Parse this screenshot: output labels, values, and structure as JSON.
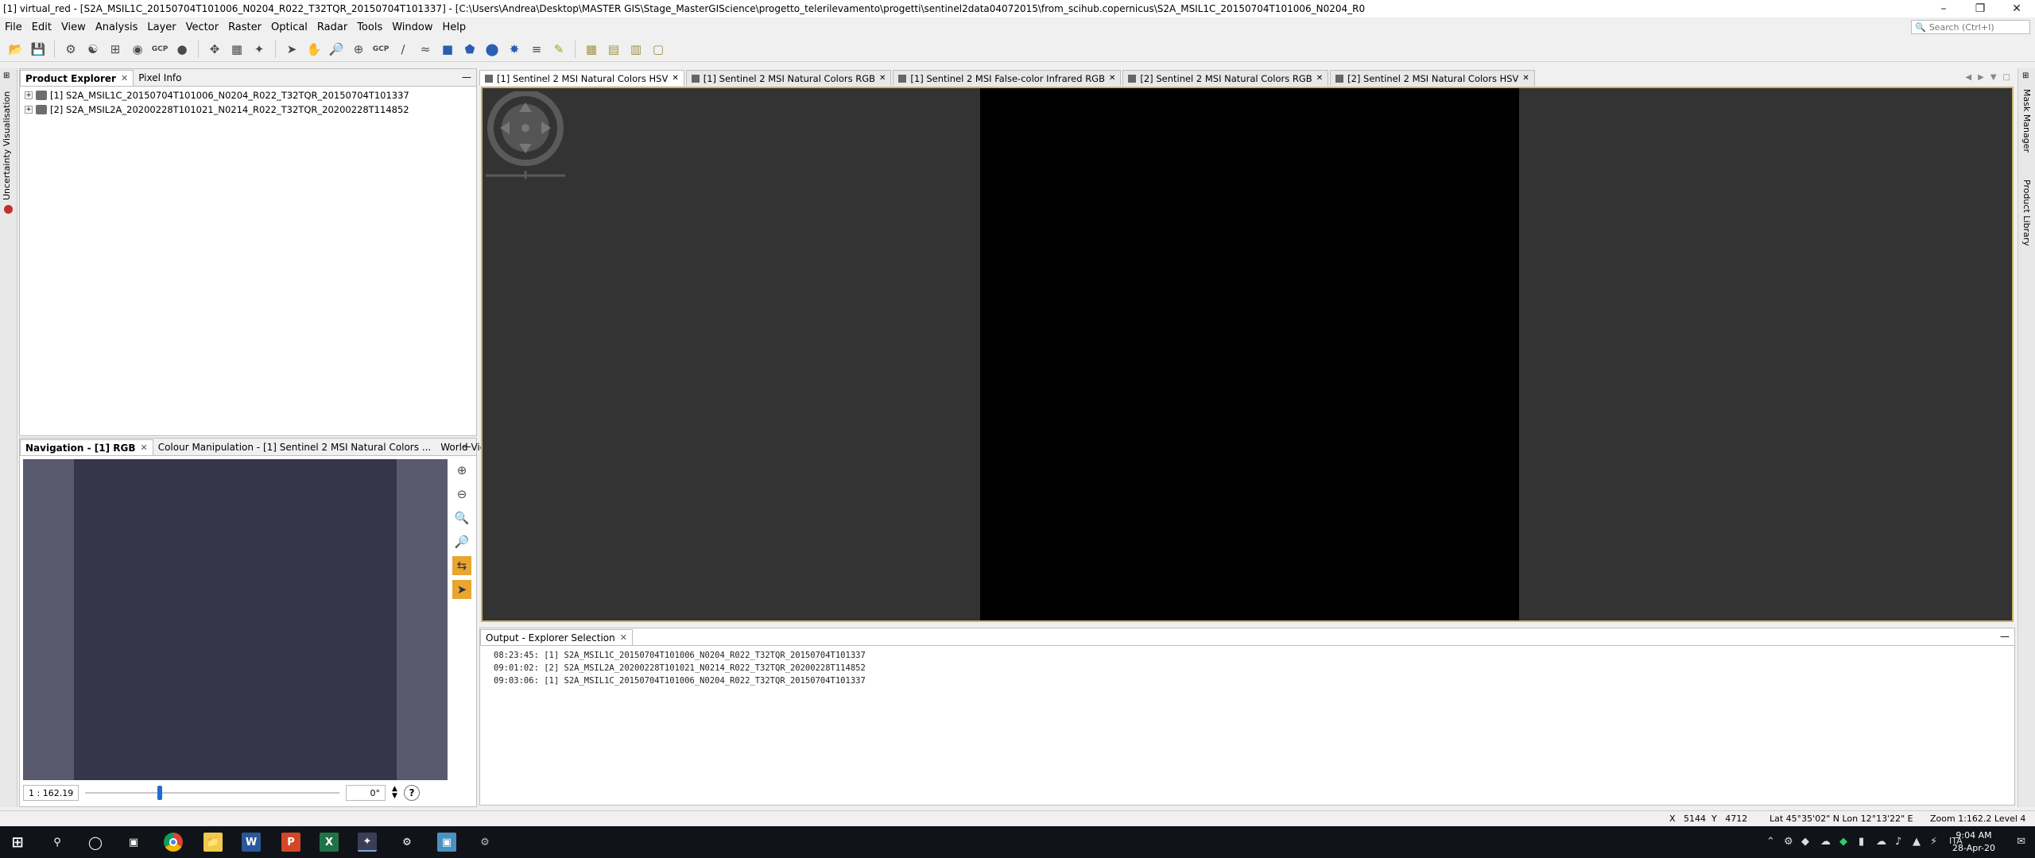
{
  "window": {
    "title": "[1] virtual_red - [S2A_MSIL1C_20150704T101006_N0204_R022_T32TQR_20150704T101337] - [C:\\Users\\Andrea\\Desktop\\MASTER GIS\\Stage_MasterGIScience\\progetto_telerilevamento\\progetti\\sentinel2data04072015\\from_scihub.copernicus\\S2A_MSIL1C_20150704T101006_N0204_R0"
  },
  "menu": [
    "File",
    "Edit",
    "View",
    "Analysis",
    "Layer",
    "Vector",
    "Raster",
    "Optical",
    "Radar",
    "Tools",
    "Window",
    "Help"
  ],
  "search": {
    "placeholder": "Search (Ctrl+I)"
  },
  "toolbar": {
    "gcp_label": "GCP"
  },
  "left_strip": {
    "label": "Uncertainty Visualisation"
  },
  "right_strip": {
    "labels": [
      "Mask Manager",
      "Product Library"
    ]
  },
  "explorer": {
    "tabs": [
      "Product Explorer",
      "Pixel Info"
    ],
    "products": [
      "[1] S2A_MSIL1C_20150704T101006_N0204_R022_T32TQR_20150704T101337",
      "[2] S2A_MSIL2A_20200228T101021_N0214_R022_T32TQR_20200228T114852"
    ]
  },
  "navigation": {
    "tabs": [
      "Navigation - [1] RGB",
      "Colour Manipulation - [1] Sentinel 2 MSI Natural Colors ...",
      "World View"
    ],
    "scale": "1 : 162.19",
    "rotation": "0°",
    "slider_fraction": 0.29
  },
  "view_tabs": [
    "[1] Sentinel 2 MSI Natural Colors HSV",
    "[1] Sentinel 2 MSI Natural Colors RGB",
    "[1] Sentinel 2 MSI False-color Infrared RGB",
    "[2] Sentinel 2 MSI Natural Colors RGB",
    "[2] Sentinel 2 MSI Natural Colors HSV"
  ],
  "output": {
    "title": "Output - Explorer Selection",
    "lines": [
      "08:23:45: [1] S2A_MSIL1C_20150704T101006_N0204_R022_T32TQR_20150704T101337",
      "09:01:02: [2] S2A_MSIL2A_20200228T101021_N0214_R022_T32TQR_20200228T114852",
      "09:03:06: [1] S2A_MSIL1C_20150704T101006_N0204_R022_T32TQR_20150704T101337"
    ]
  },
  "status": {
    "coords": "X   5144  Y   4712",
    "latlon": "Lat 45°35'02\" N  Lon 12°13'22\" E",
    "zoom": "Zoom 1:162.2  Level 4"
  },
  "taskbar": {
    "lang": "ITA",
    "time": "9:04 AM",
    "date": "28-Apr-20"
  }
}
